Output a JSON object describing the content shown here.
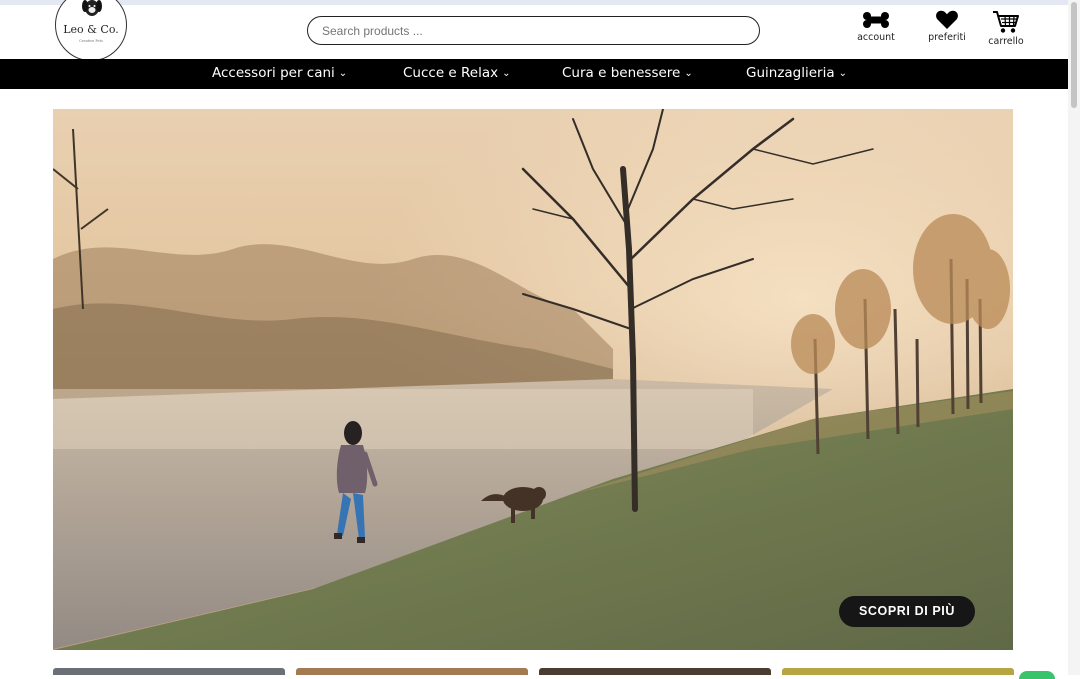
{
  "logo": {
    "name": "Leo & Co.",
    "tagline": "Creative Pets"
  },
  "search": {
    "placeholder": "Search products ..."
  },
  "header_icons": [
    {
      "label": "account",
      "icon": "bone-icon"
    },
    {
      "label": "preferiti",
      "icon": "heart-icon"
    },
    {
      "label": "carrello",
      "icon": "cart-icon"
    }
  ],
  "nav": {
    "items": [
      {
        "label": "Accessori per cani"
      },
      {
        "label": "Cucce e Relax"
      },
      {
        "label": "Cura e benessere"
      },
      {
        "label": "Guinzaglieria"
      }
    ]
  },
  "hero": {
    "cta_label": "SCOPRI DI PIÙ"
  },
  "colors": {
    "nav_bg": "#000000",
    "cta_bg": "#161616",
    "chat_green": "#38c46a"
  }
}
